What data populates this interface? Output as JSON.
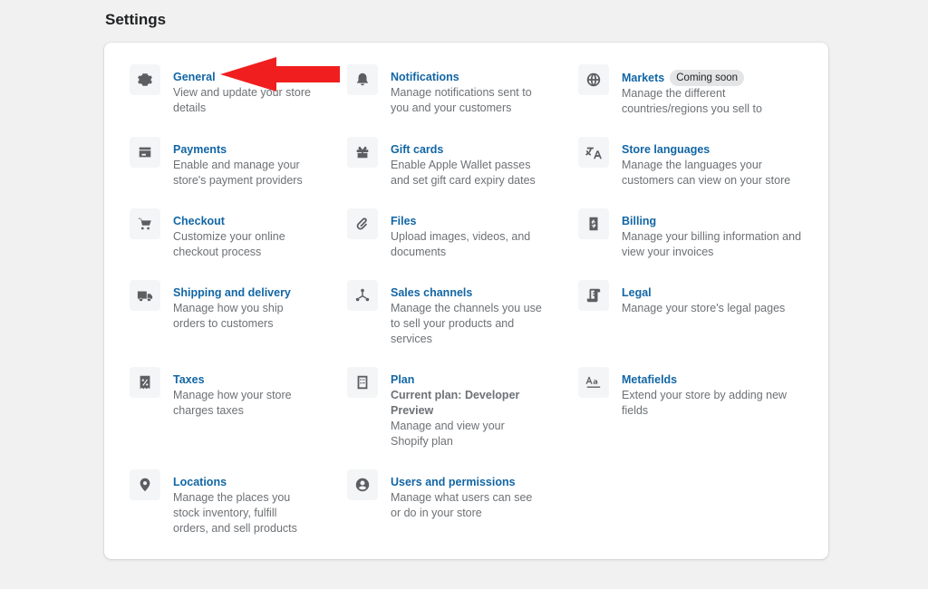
{
  "page": {
    "title": "Settings"
  },
  "items": [
    {
      "title": "General",
      "desc": "View and update your store details",
      "icon": "gear-icon"
    },
    {
      "title": "Notifications",
      "desc": "Manage notifications sent to you and your customers",
      "icon": "bell-icon"
    },
    {
      "title": "Markets",
      "badge": "Coming soon",
      "desc": "Manage the different countries/regions you sell to",
      "icon": "globe-icon"
    },
    {
      "title": "Payments",
      "desc": "Enable and manage your store's payment providers",
      "icon": "credit-card-icon"
    },
    {
      "title": "Gift cards",
      "desc": "Enable Apple Wallet passes and set gift card expiry dates",
      "icon": "gift-icon"
    },
    {
      "title": "Store languages",
      "desc": "Manage the languages your customers can view on your store",
      "icon": "translate-icon"
    },
    {
      "title": "Checkout",
      "desc": "Customize your online checkout process",
      "icon": "cart-icon"
    },
    {
      "title": "Files",
      "desc": "Upload images, videos, and documents",
      "icon": "paperclip-icon"
    },
    {
      "title": "Billing",
      "desc": "Manage your billing information and view your invoices",
      "icon": "dollar-icon"
    },
    {
      "title": "Shipping and delivery",
      "desc": "Manage how you ship orders to customers",
      "icon": "truck-icon"
    },
    {
      "title": "Sales channels",
      "desc": "Manage the channels you use to sell your products and services",
      "icon": "channels-icon"
    },
    {
      "title": "Legal",
      "desc": "Manage your store's legal pages",
      "icon": "scroll-icon"
    },
    {
      "title": "Taxes",
      "desc": "Manage how your store charges taxes",
      "icon": "tax-receipt-icon"
    },
    {
      "title": "Plan",
      "sub": "Current plan: Developer Preview",
      "desc": "Manage and view your Shopify plan",
      "icon": "checklist-icon"
    },
    {
      "title": "Metafields",
      "desc": "Extend your store by adding new fields",
      "icon": "metafields-icon"
    },
    {
      "title": "Locations",
      "desc": "Manage the places you stock inventory, fulfill orders, and sell products",
      "icon": "location-pin-icon"
    },
    {
      "title": "Users and permissions",
      "desc": "Manage what users can see or do in your store",
      "icon": "user-circle-icon"
    }
  ],
  "colors": {
    "link": "#1266a5",
    "arrow": "#f01e1e",
    "background": "#f1f1f1"
  }
}
